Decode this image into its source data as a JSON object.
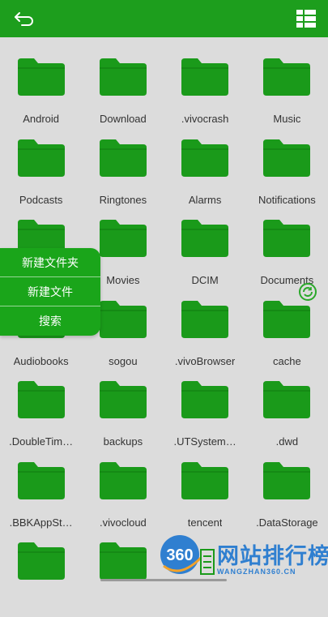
{
  "colors": {
    "accent": "#1d9e1d",
    "folder": "#1a9a1a",
    "background": "#dcdcdc"
  },
  "topbar": {
    "back_icon": "back-arrow-icon",
    "view_icon": "list-grid-toggle-icon"
  },
  "folders": [
    {
      "name": "Android"
    },
    {
      "name": "Download"
    },
    {
      "name": ".vivocrash"
    },
    {
      "name": "Music"
    },
    {
      "name": "Podcasts"
    },
    {
      "name": "Ringtones"
    },
    {
      "name": "Alarms"
    },
    {
      "name": "Notifications"
    },
    {
      "name": ""
    },
    {
      "name": "Movies"
    },
    {
      "name": "DCIM"
    },
    {
      "name": "Documents"
    },
    {
      "name": "Audiobooks"
    },
    {
      "name": "sogou"
    },
    {
      "name": ".vivoBrowser"
    },
    {
      "name": "cache"
    },
    {
      "name": ".DoubleTim…"
    },
    {
      "name": "backups"
    },
    {
      "name": ".UTSystem…"
    },
    {
      "name": ".dwd"
    },
    {
      "name": ".BBKAppSt…"
    },
    {
      "name": ".vivocloud"
    },
    {
      "name": "tencent"
    },
    {
      "name": ".DataStorage"
    },
    {
      "name": ""
    },
    {
      "name": ""
    }
  ],
  "popup_menu": {
    "items": [
      "新建文件夹",
      "新建文件",
      "搜索"
    ]
  },
  "watermark": {
    "logo": "360",
    "text": "网站排行榜",
    "subtext": "WANGZHAN360.CN"
  }
}
